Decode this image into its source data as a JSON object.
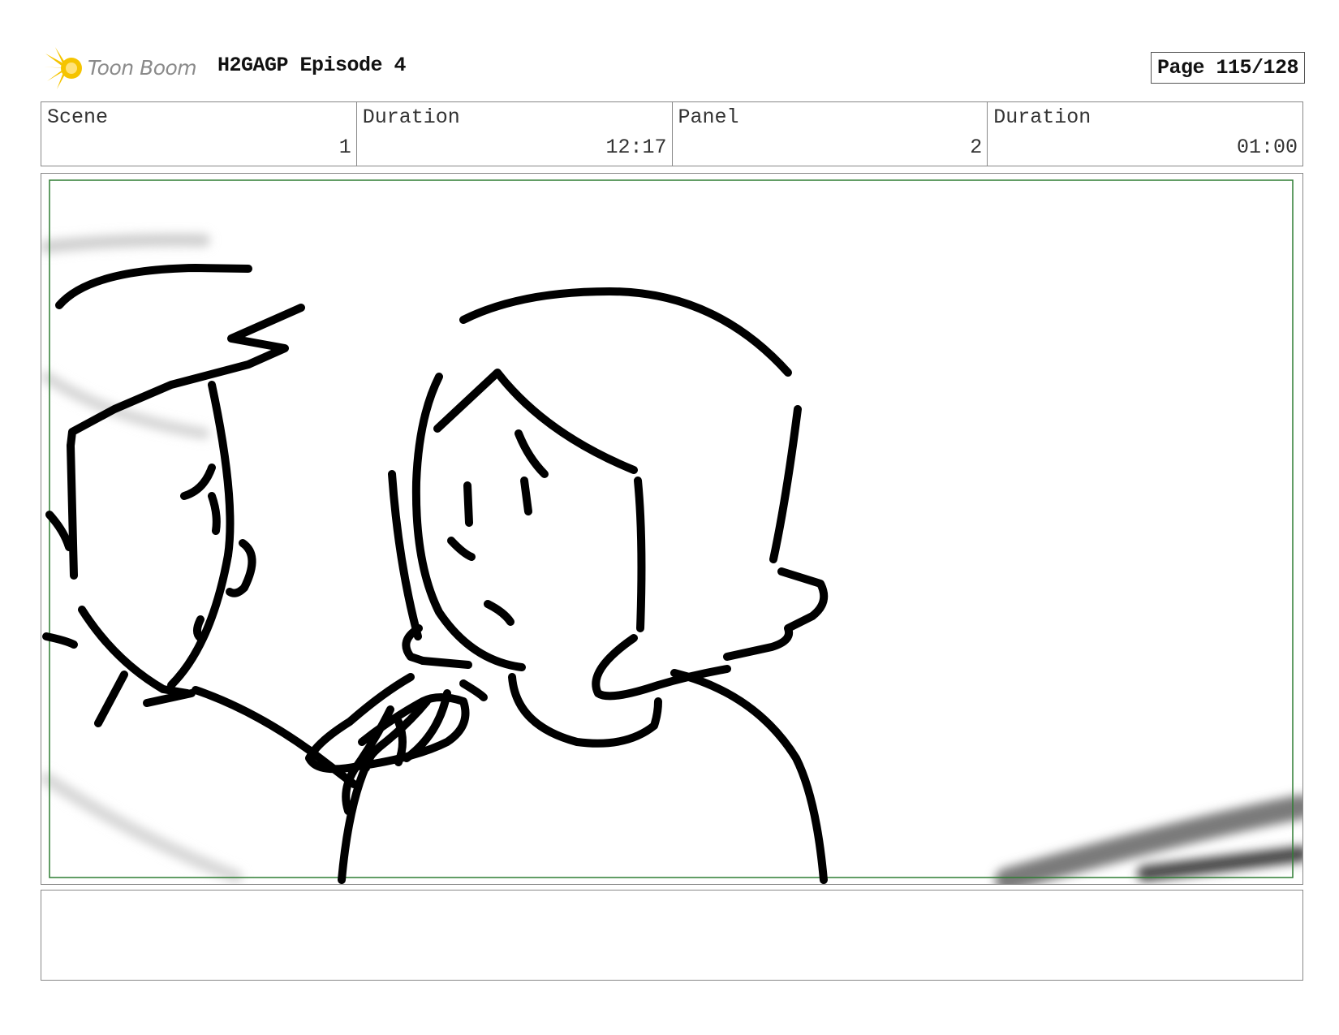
{
  "header": {
    "logo_text": "Toon Boom",
    "project_title": "H2GAGP Episode 4",
    "page_label": "Page 115/128"
  },
  "info": {
    "scene_label": "Scene",
    "scene_value": "1",
    "scene_duration_label": "Duration",
    "scene_duration_value": "12:17",
    "panel_label": "Panel",
    "panel_value": "2",
    "panel_duration_label": "Duration",
    "panel_duration_value": "01:00"
  },
  "colors": {
    "safe_frame": "#2e7d32",
    "sketch_ink": "#000000",
    "logo_yellow": "#f5c400",
    "logo_text": "#8a8a8a"
  },
  "notes": {
    "text": ""
  }
}
